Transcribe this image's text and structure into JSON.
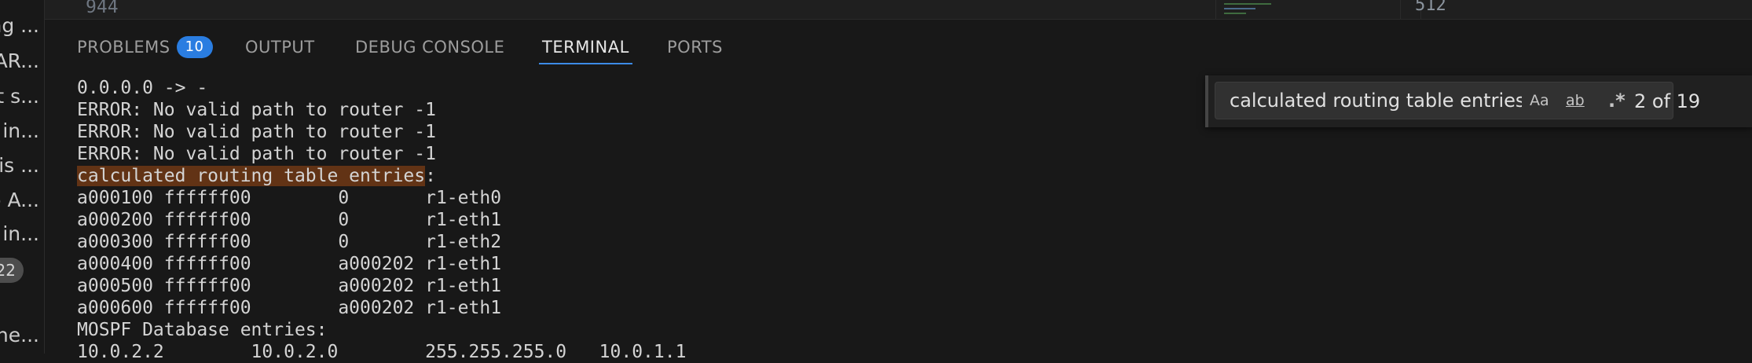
{
  "sidebar": {
    "items": [
      "ng ...",
      "AR...",
      "t s...",
      "in...",
      "is ...",
      "o A...",
      "in...",
      "the..."
    ],
    "badge": "22"
  },
  "editor": {
    "line_number": "944",
    "right_line_number": "512"
  },
  "panel": {
    "tabs": [
      {
        "label": "PROBLEMS",
        "badge": "10"
      },
      {
        "label": "OUTPUT"
      },
      {
        "label": "DEBUG CONSOLE"
      },
      {
        "label": "TERMINAL",
        "active": true
      },
      {
        "label": "PORTS"
      }
    ]
  },
  "terminal": {
    "lines": [
      "0.0.0.0 -> -",
      "ERROR: No valid path to router -1",
      "ERROR: No valid path to router -1",
      "ERROR: No valid path to router -1",
      "",
      "a000100 ffffff00        0       r1-eth0",
      "a000200 ffffff00        0       r1-eth1",
      "a000300 ffffff00        0       r1-eth2",
      "a000400 ffffff00        a000202 r1-eth1",
      "a000500 ffffff00        a000202 r1-eth1",
      "a000600 ffffff00        a000202 r1-eth1",
      "MOSPF Database entries:",
      "10.0.2.2        10.0.2.0        255.255.255.0   10.0.1.1"
    ],
    "highlight_text": "calculated routing table entries",
    "highlight_suffix": ":"
  },
  "find": {
    "value": "calculated routing table entries",
    "match_case": "Aa",
    "whole_word": "ab",
    "regex": ".*",
    "count": "2 of 19"
  },
  "colors": {
    "background": "#181818",
    "accent": "#2a7de1",
    "highlight": "#623315"
  }
}
